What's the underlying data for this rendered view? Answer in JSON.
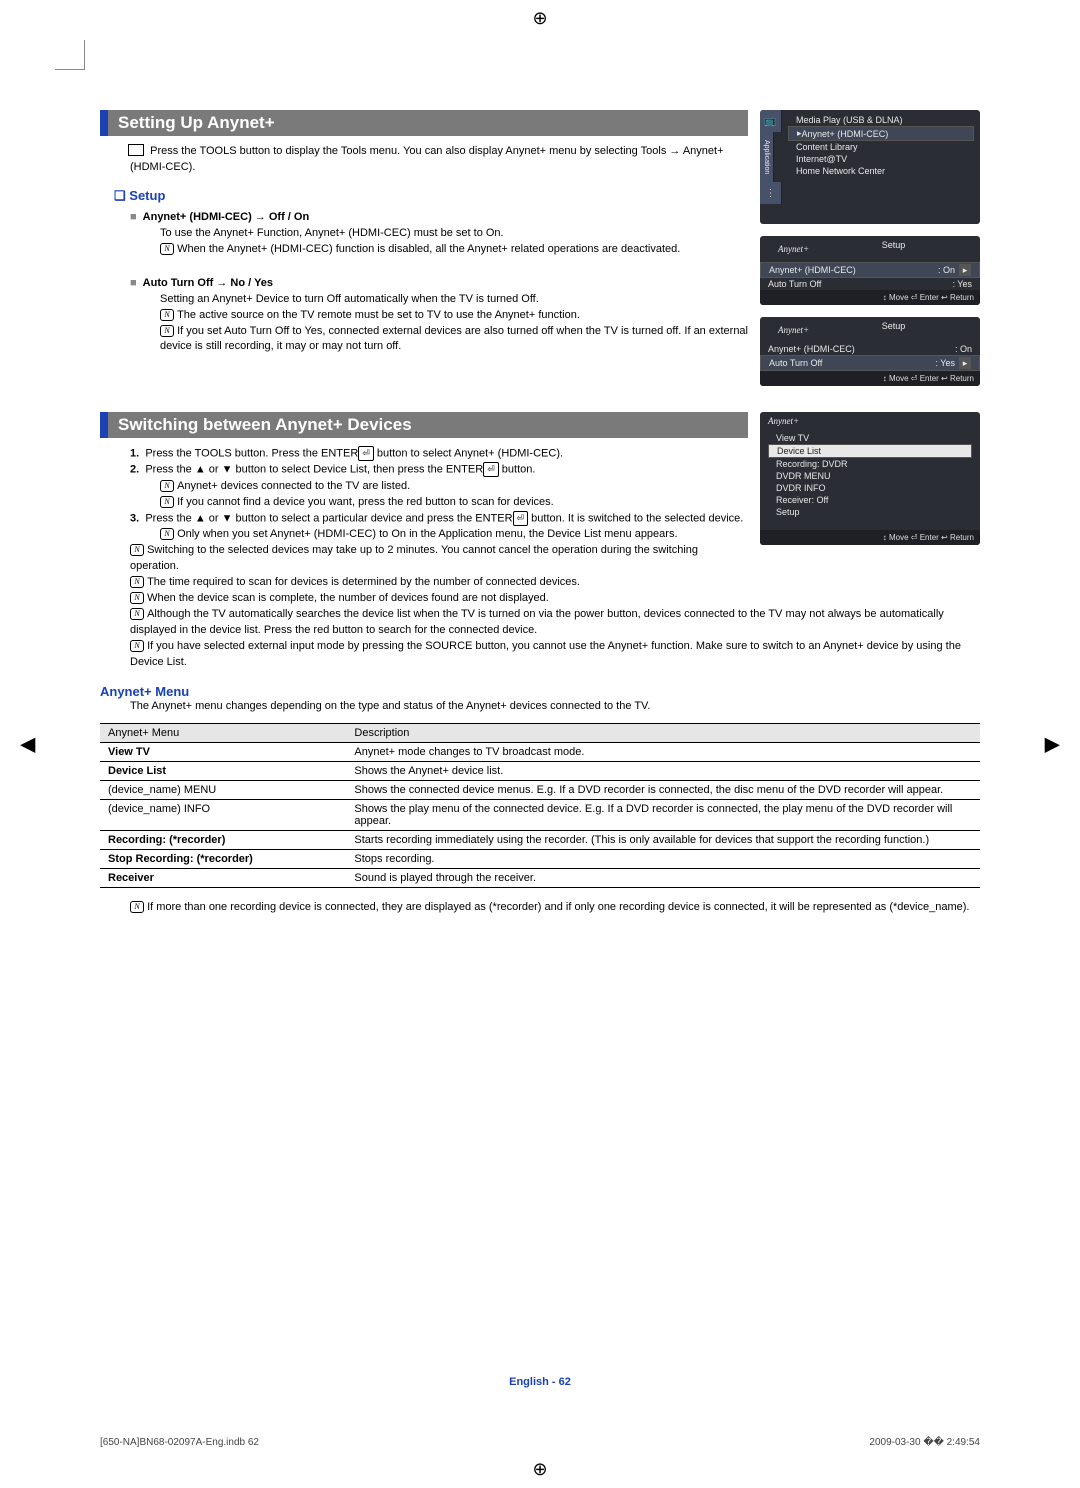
{
  "heading1": "Setting Up Anynet+",
  "intro": "Press the TOOLS button to display the Tools menu. You can also display Anynet+ menu by selecting Tools → Anynet+ (HDMI-CEC).",
  "setup": {
    "title": "Setup",
    "item1_title": "Anynet+ (HDMI-CEC) → Off / On",
    "item1_body": "To use the Anynet+ Function, Anynet+ (HDMI-CEC) must be set to On.",
    "item1_note": "When the Anynet+ (HDMI-CEC) function is disabled, all the Anynet+ related operations are deactivated.",
    "item2_title": "Auto Turn Off → No / Yes",
    "item2_body": "Setting an Anynet+ Device to turn Off automatically when the TV is turned Off.",
    "item2_note1": "The active source on the TV remote must be set to TV to use the Anynet+ function.",
    "item2_note2": "If you set Auto Turn Off to Yes, connected external devices are also turned off when the TV is turned off. If an external device is still recording, it may or may not turn off."
  },
  "heading2": "Switching between Anynet+ Devices",
  "switch": {
    "s1": "Press the TOOLS button. Press the ENTER",
    "s1b": " button to select Anynet+ (HDMI-CEC).",
    "s2": "Press the ▲ or ▼ button to select Device List, then press the ENTER",
    "s2b": " button.",
    "s2n1": "Anynet+ devices connected to the TV are listed.",
    "s2n2": "If you cannot find a device you want, press the red button to scan for devices.",
    "s3": "Press the ▲ or ▼ button to select a particular device and press the ENTER",
    "s3b": " button. It is switched to the selected device.",
    "s3n1": "Only when you set Anynet+ (HDMI-CEC) to On in the Application menu, the Device List menu appears.",
    "n1": "Switching to the selected devices may take up to 2 minutes. You cannot cancel the operation during the switching operation.",
    "n2": "The time required to scan for devices is determined by the number of connected devices.",
    "n3": "When the device scan is complete, the number of devices found are not displayed.",
    "n4": "Although the TV automatically searches the device list when the TV is turned on via the power button, devices connected to the TV may not always be automatically displayed in the device list. Press the red button to search for the connected device.",
    "n5": "If you have selected external input mode by pressing the SOURCE button, you cannot use the Anynet+ function. Make sure to switch to an Anynet+ device by using the Device List."
  },
  "menu": {
    "title": "Anynet+ Menu",
    "intro": "The Anynet+ menu changes depending on the type and status of the Anynet+ devices connected to the TV.",
    "th1": "Anynet+ Menu",
    "th2": "Description",
    "rows": [
      {
        "a": "View TV",
        "b": "Anynet+ mode changes to TV broadcast mode."
      },
      {
        "a": "Device List",
        "b": "Shows the Anynet+ device list."
      },
      {
        "a": "(device_name) MENU",
        "b": "Shows the connected device menus. E.g. If a DVD recorder is connected, the disc menu of the DVD recorder will appear."
      },
      {
        "a": "(device_name) INFO",
        "b": "Shows the play menu of the connected device. E.g. If a DVD recorder is connected, the play menu of the DVD recorder will appear."
      },
      {
        "a": "Recording: (*recorder)",
        "b": "Starts recording immediately using the recorder. (This is only available for devices that support the recording function.)"
      },
      {
        "a": "Stop Recording: (*recorder)",
        "b": "Stops recording."
      },
      {
        "a": "Receiver",
        "b": "Sound is played through the receiver."
      }
    ],
    "footnote": "If more than one recording device is connected, they are displayed as (*recorder) and if only one recording device is connected, it will be represented as (*device_name)."
  },
  "osd1": {
    "items": [
      "Media Play (USB & DLNA)",
      "Anynet+ (HDMI-CEC)",
      "Content Library",
      "Internet@TV",
      "Home Network Center"
    ],
    "tab": "Application"
  },
  "osd2": {
    "brand": "Anynet+",
    "title": "Setup",
    "r1a": "Anynet+ (HDMI-CEC)",
    "r1b": ": On",
    "r2a": "Auto Turn Off",
    "r2b": ": Yes",
    "foot": "↕ Move   ⏎ Enter   ↩ Return"
  },
  "osd3": {
    "brand": "Anynet+",
    "title": "Setup",
    "r1a": "Anynet+ (HDMI-CEC)",
    "r1b": ": On",
    "r2a": "Auto Turn Off",
    "r2b": ": Yes",
    "foot": "↕ Move   ⏎ Enter   ↩ Return"
  },
  "osd4": {
    "brand": "Anynet+",
    "items": [
      "View TV",
      "Device List",
      "Recording: DVDR",
      "DVDR MENU",
      "DVDR INFO",
      "Receiver: Off",
      "Setup"
    ],
    "foot": "↕ Move   ⏎ Enter   ↩ Return"
  },
  "pagefoot": "English - 62",
  "printLeft": "[650-NA]BN68-02097A-Eng.indb   62",
  "printRight": "2009-03-30   �� 2:49:54"
}
